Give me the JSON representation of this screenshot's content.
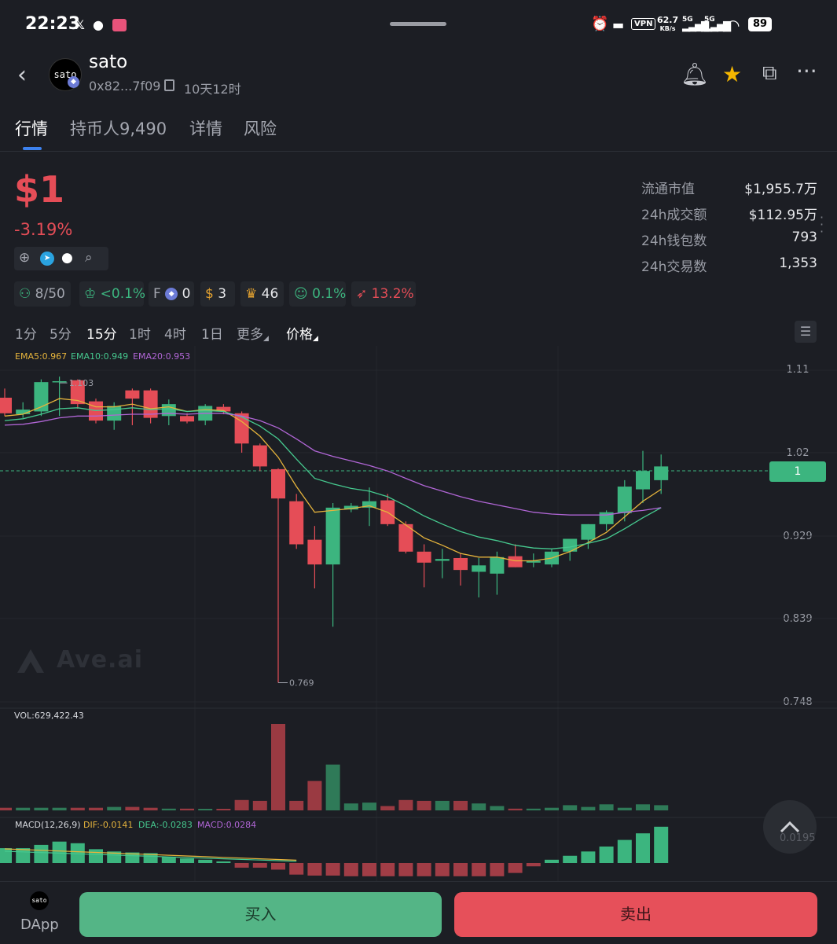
{
  "status_bar": {
    "time": "22:23",
    "net_speed": "62.7",
    "net_unit": "KB/s",
    "vpn": "VPN",
    "sig1": "5G",
    "sig2": "5G",
    "battery": "89"
  },
  "header": {
    "avatar_text": "sato",
    "token_name": "sato",
    "address": "0x82...7f09",
    "age": "10天12时"
  },
  "tabs": [
    {
      "label": "行情"
    },
    {
      "label": "持币人9,490"
    },
    {
      "label": "详情"
    },
    {
      "label": "风险"
    }
  ],
  "price": {
    "value": "$1",
    "change": "-3.19%"
  },
  "stats": [
    {
      "label": "流通市值",
      "value": "$1,955.7万"
    },
    {
      "label": "24h成交额",
      "value": "$112.95万"
    },
    {
      "label": "24h钱包数",
      "value": "793"
    },
    {
      "label": "24h交易数",
      "value": "1,353"
    }
  ],
  "tags": [
    {
      "icon": "user-icon",
      "text": "8/50"
    },
    {
      "icon": "chef-hat-icon",
      "text": "<0.1%"
    },
    {
      "icon": "eth-icon",
      "prefix": "F",
      "text": "0"
    },
    {
      "icon": "money-bag-icon",
      "text": "3"
    },
    {
      "icon": "trophy-icon",
      "text": "46"
    },
    {
      "icon": "robot-icon",
      "text": "0.1%"
    },
    {
      "icon": "rocket-icon",
      "text": "13.2%"
    }
  ],
  "intervals": [
    "1分",
    "5分",
    "15分",
    "1时",
    "4时",
    "1日",
    "更多"
  ],
  "price_mode": "价格",
  "ema": {
    "ema5": "EMA5:0.967",
    "ema10": "EMA10:0.949",
    "ema20": "EMA20:0.953"
  },
  "y_axis": [
    "1.11",
    "1.02",
    "0.929",
    "0.839",
    "0.748"
  ],
  "current_price_tag": "1",
  "high_label": "1.103",
  "low_label": "0.769",
  "watermark": "Ave.ai",
  "volume": {
    "label": "VOL:629,422.43"
  },
  "macd": {
    "label": "MACD(12,26,9)",
    "dif": "DIF:-0.0141",
    "dea": "DEA:-0.0283",
    "macd": "MACD:0.0284",
    "axis_value": "0.0195"
  },
  "bottom": {
    "dapp_avatar": "sato",
    "dapp_label": "DApp",
    "buy": "买入",
    "sell": "卖出"
  },
  "colors": {
    "up": "#3cb57f",
    "down": "#e54d57",
    "ema5": "#e6b43c",
    "ema10": "#46c98f",
    "ema20": "#b166d6",
    "accent": "#3d82ef"
  },
  "chart_data": {
    "type": "candlestick",
    "interval": "15分",
    "y_ticks": [
      1.11,
      1.02,
      0.929,
      0.839,
      0.748
    ],
    "ylim": [
      0.748,
      1.11
    ],
    "candles": [
      {
        "o": 1.08,
        "h": 1.09,
        "l": 1.06,
        "c": 1.063
      },
      {
        "o": 1.062,
        "h": 1.075,
        "l": 1.058,
        "c": 1.067
      },
      {
        "o": 1.065,
        "h": 1.1,
        "l": 1.06,
        "c": 1.097
      },
      {
        "o": 1.097,
        "h": 1.103,
        "l": 1.06,
        "c": 1.098
      },
      {
        "o": 1.099,
        "h": 1.1,
        "l": 1.068,
        "c": 1.073
      },
      {
        "o": 1.076,
        "h": 1.079,
        "l": 1.052,
        "c": 1.055
      },
      {
        "o": 1.055,
        "h": 1.075,
        "l": 1.045,
        "c": 1.071
      },
      {
        "o": 1.088,
        "h": 1.09,
        "l": 1.05,
        "c": 1.079
      },
      {
        "o": 1.088,
        "h": 1.09,
        "l": 1.052,
        "c": 1.058
      },
      {
        "o": 1.06,
        "h": 1.078,
        "l": 1.05,
        "c": 1.073
      },
      {
        "o": 1.06,
        "h": 1.063,
        "l": 1.052,
        "c": 1.054
      },
      {
        "o": 1.055,
        "h": 1.073,
        "l": 1.05,
        "c": 1.071
      },
      {
        "o": 1.07,
        "h": 1.073,
        "l": 1.062,
        "c": 1.065
      },
      {
        "o": 1.063,
        "h": 1.065,
        "l": 1.02,
        "c": 1.03
      },
      {
        "o": 1.028,
        "h": 1.03,
        "l": 1.0,
        "c": 1.005
      },
      {
        "o": 1.002,
        "h": 1.003,
        "l": 0.769,
        "c": 0.97
      },
      {
        "o": 0.967,
        "h": 0.975,
        "l": 0.915,
        "c": 0.92
      },
      {
        "o": 0.925,
        "h": 0.94,
        "l": 0.872,
        "c": 0.898
      },
      {
        "o": 0.898,
        "h": 0.965,
        "l": 0.83,
        "c": 0.96
      },
      {
        "o": 0.958,
        "h": 0.965,
        "l": 0.955,
        "c": 0.962
      },
      {
        "o": 0.96,
        "h": 0.982,
        "l": 0.94,
        "c": 0.967
      },
      {
        "o": 0.968,
        "h": 0.975,
        "l": 0.94,
        "c": 0.942
      },
      {
        "o": 0.942,
        "h": 0.945,
        "l": 0.91,
        "c": 0.912
      },
      {
        "o": 0.912,
        "h": 0.92,
        "l": 0.873,
        "c": 0.9
      },
      {
        "o": 0.902,
        "h": 0.915,
        "l": 0.883,
        "c": 0.904
      },
      {
        "o": 0.905,
        "h": 0.91,
        "l": 0.875,
        "c": 0.892
      },
      {
        "o": 0.89,
        "h": 0.905,
        "l": 0.862,
        "c": 0.897
      },
      {
        "o": 0.888,
        "h": 0.912,
        "l": 0.865,
        "c": 0.906
      },
      {
        "o": 0.907,
        "h": 0.92,
        "l": 0.895,
        "c": 0.895
      },
      {
        "o": 0.9,
        "h": 0.91,
        "l": 0.895,
        "c": 0.902
      },
      {
        "o": 0.898,
        "h": 0.915,
        "l": 0.895,
        "c": 0.912
      },
      {
        "o": 0.912,
        "h": 0.925,
        "l": 0.902,
        "c": 0.926
      },
      {
        "o": 0.925,
        "h": 0.942,
        "l": 0.915,
        "c": 0.942
      },
      {
        "o": 0.942,
        "h": 0.957,
        "l": 0.935,
        "c": 0.955
      },
      {
        "o": 0.954,
        "h": 0.99,
        "l": 0.945,
        "c": 0.983
      },
      {
        "o": 0.98,
        "h": 1.022,
        "l": 0.965,
        "c": 1.0
      },
      {
        "o": 0.99,
        "h": 1.018,
        "l": 0.975,
        "c": 1.005
      }
    ],
    "ema5": [
      1.06,
      1.062,
      1.07,
      1.079,
      1.077,
      1.07,
      1.07,
      1.073,
      1.068,
      1.07,
      1.065,
      1.067,
      1.066,
      1.054,
      1.038,
      1.015,
      0.983,
      0.955,
      0.957,
      0.959,
      0.962,
      0.955,
      0.941,
      0.927,
      0.919,
      0.91,
      0.906,
      0.906,
      0.902,
      0.902,
      0.905,
      0.912,
      0.922,
      0.933,
      0.95,
      0.967,
      0.98
    ],
    "ema10": [
      1.055,
      1.057,
      1.062,
      1.068,
      1.069,
      1.066,
      1.067,
      1.069,
      1.067,
      1.068,
      1.065,
      1.066,
      1.065,
      1.059,
      1.049,
      1.035,
      1.013,
      0.992,
      0.986,
      0.981,
      0.978,
      0.972,
      0.962,
      0.951,
      0.942,
      0.934,
      0.928,
      0.924,
      0.919,
      0.916,
      0.915,
      0.917,
      0.921,
      0.926,
      0.937,
      0.949,
      0.96
    ],
    "ema20": [
      1.05,
      1.051,
      1.054,
      1.058,
      1.06,
      1.06,
      1.061,
      1.062,
      1.062,
      1.063,
      1.062,
      1.063,
      1.063,
      1.06,
      1.055,
      1.047,
      1.035,
      1.022,
      1.016,
      1.011,
      1.006,
      1.0,
      0.992,
      0.984,
      0.978,
      0.972,
      0.967,
      0.963,
      0.959,
      0.955,
      0.953,
      0.952,
      0.952,
      0.952,
      0.955,
      0.957,
      0.96
    ],
    "volume_rel": [
      0.03,
      0.03,
      0.03,
      0.03,
      0.03,
      0.03,
      0.04,
      0.04,
      0.03,
      0.02,
      0.02,
      0.01,
      0.01,
      0.12,
      0.11,
      1.0,
      0.11,
      0.34,
      0.53,
      0.08,
      0.09,
      0.05,
      0.12,
      0.11,
      0.11,
      0.11,
      0.08,
      0.05,
      0.02,
      0.02,
      0.03,
      0.06,
      0.04,
      0.07,
      0.03,
      0.07,
      0.06
    ],
    "macd_rel": [
      0.45,
      0.45,
      0.55,
      0.65,
      0.6,
      0.42,
      0.35,
      0.32,
      0.3,
      0.18,
      0.14,
      0.1,
      0.05,
      -0.14,
      -0.14,
      -0.2,
      -0.35,
      -0.38,
      -0.38,
      -0.4,
      -0.4,
      -0.4,
      -0.4,
      -0.4,
      -0.4,
      -0.4,
      -0.4,
      -0.4,
      -0.3,
      -0.1,
      0.1,
      0.22,
      0.35,
      0.5,
      0.7,
      0.9,
      1.1
    ]
  }
}
